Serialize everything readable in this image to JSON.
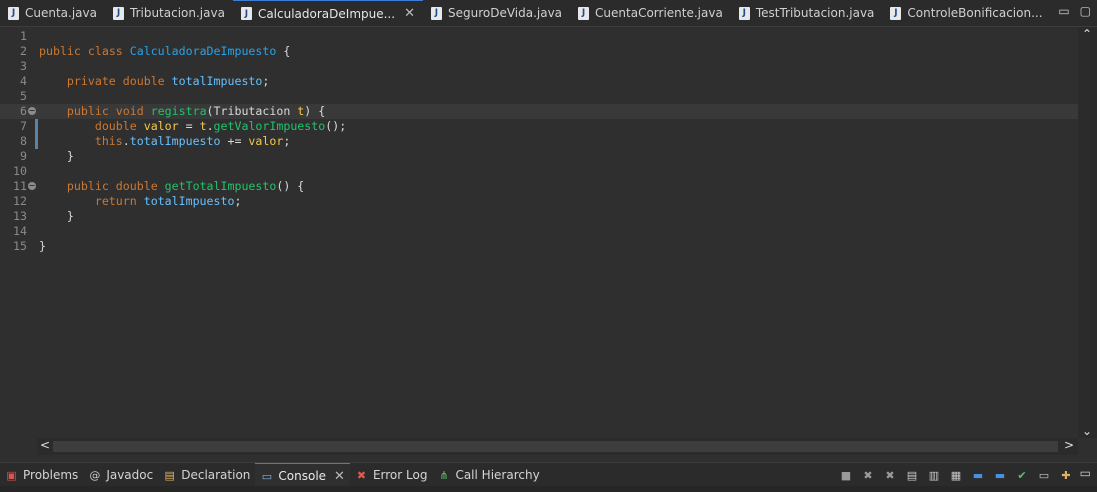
{
  "editor_tabs": [
    {
      "label": "Cuenta.java",
      "active": false,
      "closable": false
    },
    {
      "label": "Tributacion.java",
      "active": false,
      "closable": false
    },
    {
      "label": "CalculadoraDeImpue...",
      "active": true,
      "closable": true
    },
    {
      "label": "SeguroDeVida.java",
      "active": false,
      "closable": false
    },
    {
      "label": "CuentaCorriente.java",
      "active": false,
      "closable": false
    },
    {
      "label": "TestTributacion.java",
      "active": false,
      "closable": false
    },
    {
      "label": "ControleBonificacion...",
      "active": false,
      "closable": false
    }
  ],
  "tab_icon_glyph": "J",
  "close_glyph": "✕",
  "window_controls": {
    "minimize": "▭",
    "maximize": "▢"
  },
  "code_lines": [
    {
      "n": "1",
      "tokens": []
    },
    {
      "n": "2",
      "tokens": [
        [
          "kw",
          "public"
        ],
        [
          "t",
          " "
        ],
        [
          "kw",
          "class"
        ],
        [
          "t",
          " "
        ],
        [
          "cls",
          "CalculadoraDeImpuesto"
        ],
        [
          "t",
          " {"
        ]
      ]
    },
    {
      "n": "3",
      "tokens": []
    },
    {
      "n": "4",
      "tokens": [
        [
          "t",
          "    "
        ],
        [
          "kw",
          "private"
        ],
        [
          "t",
          " "
        ],
        [
          "kw",
          "double"
        ],
        [
          "t",
          " "
        ],
        [
          "fld",
          "totalImpuesto"
        ],
        [
          "t",
          ";"
        ]
      ]
    },
    {
      "n": "5",
      "tokens": []
    },
    {
      "n": "6",
      "fold": true,
      "current": true,
      "tokens": [
        [
          "t",
          "    "
        ],
        [
          "kw",
          "public"
        ],
        [
          "t",
          " "
        ],
        [
          "kw",
          "void"
        ],
        [
          "t",
          " "
        ],
        [
          "mth",
          "registra"
        ],
        [
          "t",
          "("
        ],
        [
          "typ",
          "Tributacion"
        ],
        [
          "t",
          " "
        ],
        [
          "var",
          "t"
        ],
        [
          "t",
          ") {"
        ]
      ]
    },
    {
      "n": "7",
      "mark": true,
      "tokens": [
        [
          "t",
          "        "
        ],
        [
          "kw",
          "double"
        ],
        [
          "t",
          " "
        ],
        [
          "var",
          "valor"
        ],
        [
          "t",
          " = "
        ],
        [
          "var",
          "t"
        ],
        [
          "t",
          "."
        ],
        [
          "mth",
          "getValorImpuesto"
        ],
        [
          "t",
          "();"
        ]
      ]
    },
    {
      "n": "8",
      "mark": true,
      "tokens": [
        [
          "t",
          "        "
        ],
        [
          "kw",
          "this"
        ],
        [
          "t",
          "."
        ],
        [
          "fld",
          "totalImpuesto"
        ],
        [
          "t",
          " += "
        ],
        [
          "var",
          "valor"
        ],
        [
          "t",
          ";"
        ]
      ]
    },
    {
      "n": "9",
      "tokens": [
        [
          "t",
          "    }"
        ]
      ]
    },
    {
      "n": "10",
      "tokens": []
    },
    {
      "n": "11",
      "fold": true,
      "tokens": [
        [
          "t",
          "    "
        ],
        [
          "kw",
          "public"
        ],
        [
          "t",
          " "
        ],
        [
          "kw",
          "double"
        ],
        [
          "t",
          " "
        ],
        [
          "mth",
          "getTotalImpuesto"
        ],
        [
          "t",
          "() {"
        ]
      ]
    },
    {
      "n": "12",
      "tokens": [
        [
          "t",
          "        "
        ],
        [
          "kw",
          "return"
        ],
        [
          "t",
          " "
        ],
        [
          "fld",
          "totalImpuesto"
        ],
        [
          "t",
          ";"
        ]
      ]
    },
    {
      "n": "13",
      "tokens": [
        [
          "t",
          "    }"
        ]
      ]
    },
    {
      "n": "14",
      "tokens": []
    },
    {
      "n": "15",
      "tokens": [
        [
          "t",
          "}"
        ]
      ]
    }
  ],
  "scroll": {
    "up": "⌃",
    "down": "⌄",
    "left": "<",
    "right": ">"
  },
  "panel_tabs": [
    {
      "label": "Problems",
      "icon": "problems-icon",
      "glyph": "▣",
      "color": "#d9534f",
      "active": false
    },
    {
      "label": "Javadoc",
      "icon": "javadoc-icon",
      "glyph": "@",
      "color": "#c8c8c8",
      "active": false
    },
    {
      "label": "Declaration",
      "icon": "declaration-icon",
      "glyph": "▤",
      "color": "#e0b060",
      "active": false
    },
    {
      "label": "Console",
      "icon": "console-icon",
      "glyph": "▭",
      "color": "#7ab0e6",
      "active": true,
      "closable": true
    },
    {
      "label": "Error Log",
      "icon": "error-log-icon",
      "glyph": "✖",
      "color": "#e05a4f",
      "active": false
    },
    {
      "label": "Call Hierarchy",
      "icon": "call-hierarchy-icon",
      "glyph": "⋔",
      "color": "#5cbf6a",
      "active": false
    }
  ],
  "console_toolbar": [
    {
      "name": "terminate-icon",
      "glyph": "■",
      "color": "#9a9a9a"
    },
    {
      "name": "remove-launch-icon",
      "glyph": "✖",
      "color": "#9a9a9a"
    },
    {
      "name": "remove-all-launches-icon",
      "glyph": "✖",
      "color": "#9a9a9a"
    },
    {
      "name": "clear-console-icon",
      "glyph": "▤",
      "color": "#c8c8c8"
    },
    {
      "name": "scroll-lock-icon",
      "glyph": "▥",
      "color": "#c8c8c8"
    },
    {
      "name": "word-wrap-icon",
      "glyph": "▦",
      "color": "#c8c8c8"
    },
    {
      "name": "show-on-output-icon",
      "glyph": "▬",
      "color": "#4a90e2"
    },
    {
      "name": "show-on-error-icon",
      "glyph": "▬",
      "color": "#4a90e2"
    },
    {
      "name": "pin-console-icon",
      "glyph": "✔",
      "color": "#5cbf6a"
    },
    {
      "name": "display-console-icon",
      "glyph": "▭",
      "color": "#c8c8c8"
    },
    {
      "name": "open-console-icon",
      "glyph": "✚",
      "color": "#e0b060"
    }
  ],
  "colors": {
    "active_tab_border": "#3d7fd6",
    "keyword": "#cc7832",
    "class_name": "#29a3e8",
    "field": "#66c0ff",
    "method": "#1fc46b",
    "variable": "#f2c94c"
  }
}
